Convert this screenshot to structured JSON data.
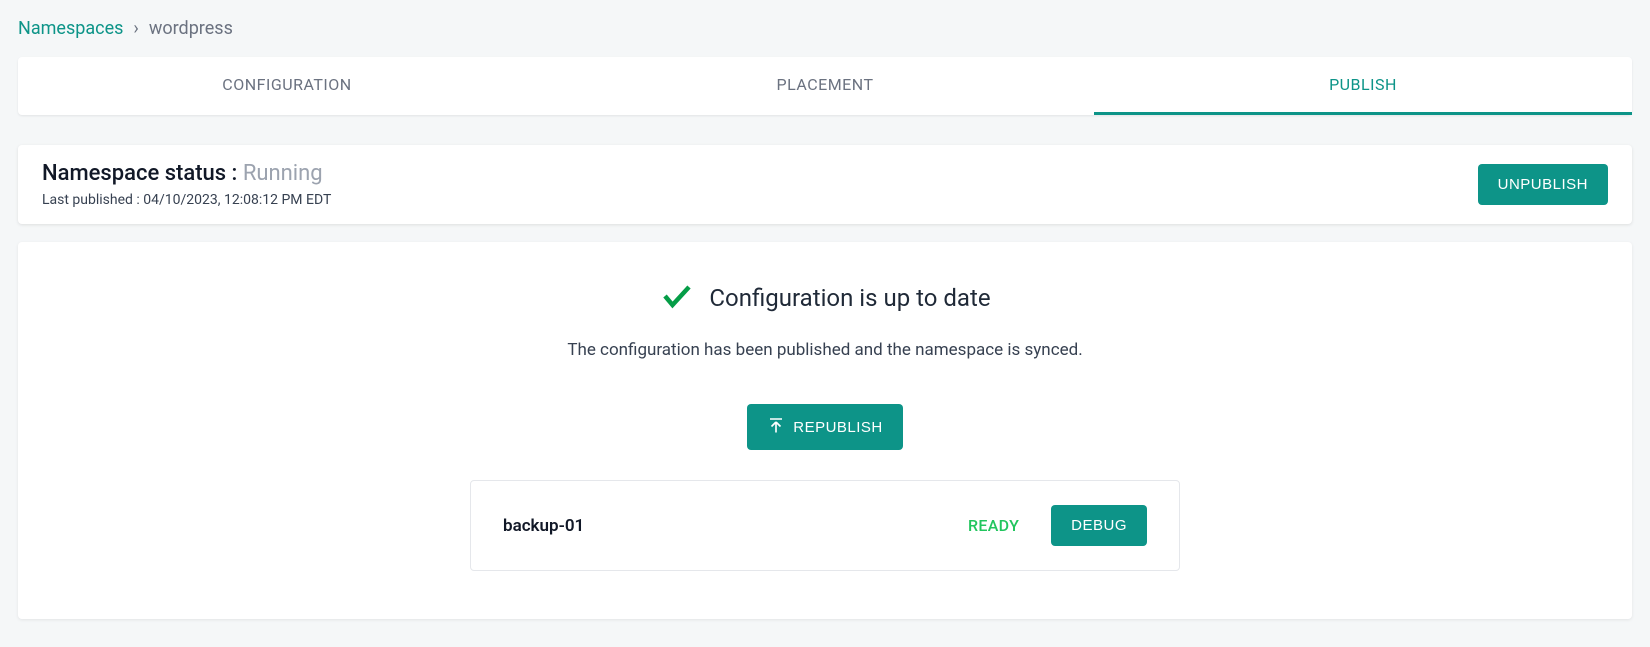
{
  "breadcrumb": {
    "root": "Namespaces",
    "separator": "›",
    "current": "wordpress"
  },
  "tabs": [
    {
      "label": "CONFIGURATION",
      "active": false
    },
    {
      "label": "PLACEMENT",
      "active": false
    },
    {
      "label": "PUBLISH",
      "active": true
    }
  ],
  "status": {
    "label_prefix": "Namespace status : ",
    "value": "Running",
    "last_published_prefix": "Last published : ",
    "last_published_value": "04/10/2023, 12:08:12 PM EDT",
    "unpublish_label": "UNPUBLISH"
  },
  "config": {
    "heading": "Configuration is up to date",
    "subtext": "The configuration has been published and the namespace is synced.",
    "republish_label": "REPUBLISH"
  },
  "deployment": {
    "name": "backup-01",
    "status": "READY",
    "debug_label": "DEBUG"
  }
}
